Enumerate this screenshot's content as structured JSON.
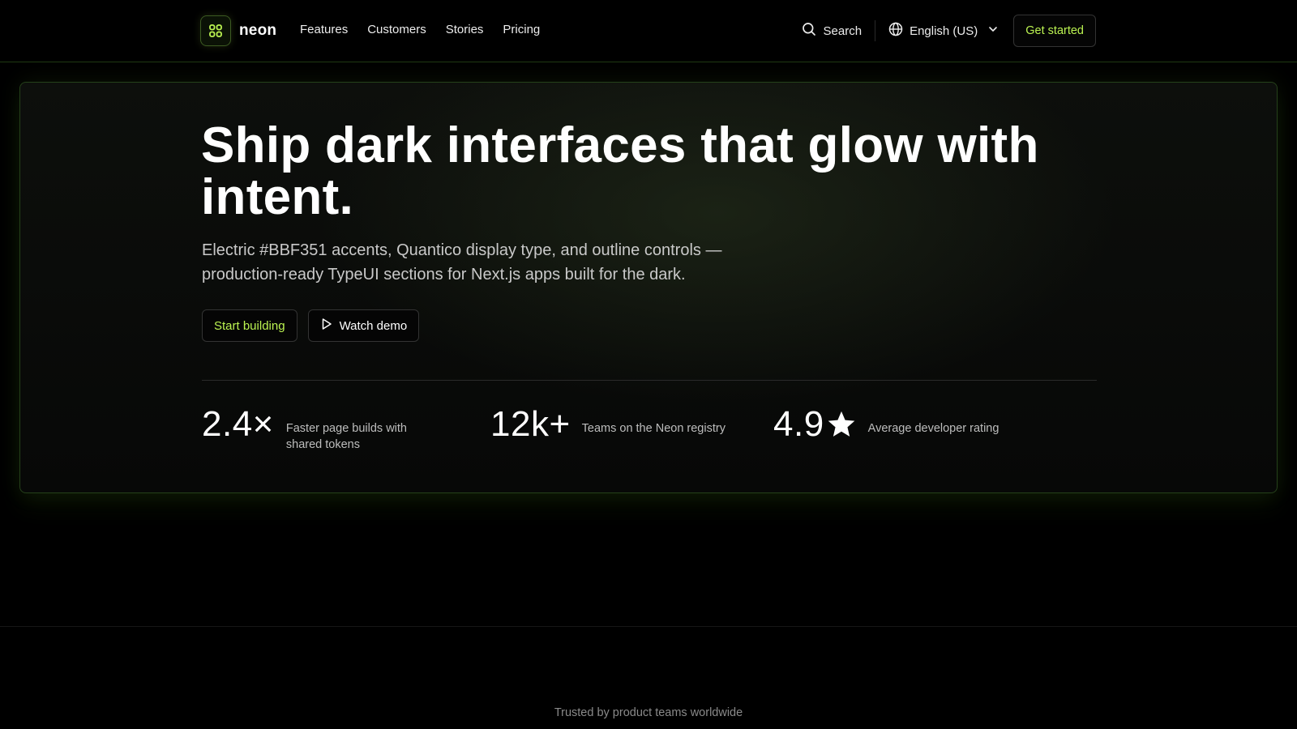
{
  "colors": {
    "accent": "#BBF351",
    "background": "#000000",
    "border": "#25411a"
  },
  "header": {
    "brand": {
      "logo_icon": "grid-four-icon",
      "name": "neon"
    },
    "nav": [
      {
        "label": "Features"
      },
      {
        "label": "Customers"
      },
      {
        "label": "Stories"
      },
      {
        "label": "Pricing"
      }
    ],
    "search": {
      "icon": "search-icon",
      "label": "Search"
    },
    "language": {
      "icon": "globe-icon",
      "label": "English (US)",
      "chevron": "chevron-down-icon"
    },
    "cta": "Get started"
  },
  "hero": {
    "title_line1": "Ship dark interfaces that glow with",
    "title_line2": "intent.",
    "subtitle_line1": "Electric #BBF351 accents, Quantico display type, and outline controls —",
    "subtitle_line2": "production-ready TypeUI sections for Next.js apps built for the dark.",
    "primary_button": "Start building",
    "secondary_button": {
      "icon": "play-icon",
      "label": "Watch demo"
    },
    "stats": [
      {
        "value": "2.4×",
        "label_line1": "Faster page builds with",
        "label_line2": "shared tokens"
      },
      {
        "value": "12k+",
        "label_line1": "Teams on the Neon registry",
        "label_line2": ""
      },
      {
        "value": "4.9",
        "icon": "star-icon",
        "label_line1": "Average developer rating",
        "label_line2": ""
      }
    ]
  },
  "trusted": {
    "text": "Trusted by product teams worldwide"
  }
}
